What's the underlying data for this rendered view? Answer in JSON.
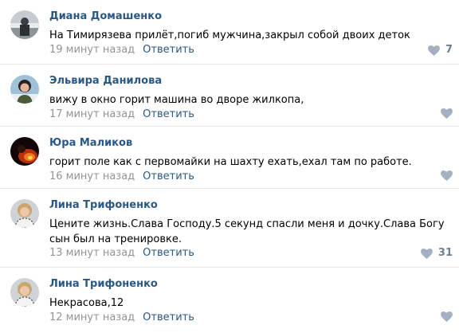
{
  "comments": [
    {
      "author": "Диана Домашенко",
      "text": "На Тимирязева прилёт,погиб мужчина,закрыл собой двоих деток",
      "time": "19 минут назад",
      "reply_label": "Ответить",
      "likes": "7",
      "avatar_icon": "avatar-photo-icon"
    },
    {
      "author": "Эльвира Данилова",
      "text": "вижу в окно горит машина во дворе жилкопа,",
      "time": "17 минут назад",
      "reply_label": "Ответить",
      "likes": "",
      "avatar_icon": "avatar-photo-icon"
    },
    {
      "author": "Юра Маликов",
      "text": "горит поле как с первомайки на шахту ехать,ехал там по работе.",
      "time": "16 минут назад",
      "reply_label": "Ответить",
      "likes": "",
      "avatar_icon": "avatar-photo-icon"
    },
    {
      "author": "Лина Трифоненко",
      "text": "Цените жизнь.Слава Господу.5 секунд спасли меня и дочку.Слава Богу сын был на тренировке.",
      "time": "13 минут назад",
      "reply_label": "Ответить",
      "likes": "31",
      "avatar_icon": "avatar-photo-icon"
    },
    {
      "author": "Лина Трифоненко",
      "text": "Некрасова,12",
      "time": "12 минут назад",
      "reply_label": "Ответить",
      "likes": "",
      "avatar_icon": "avatar-photo-icon"
    }
  ],
  "colors": {
    "author": "#2a5885",
    "meta": "#939393",
    "like_icon": "#a3b1c2",
    "divider": "#e7e8ec"
  },
  "icons": {
    "like": "heart-icon"
  }
}
